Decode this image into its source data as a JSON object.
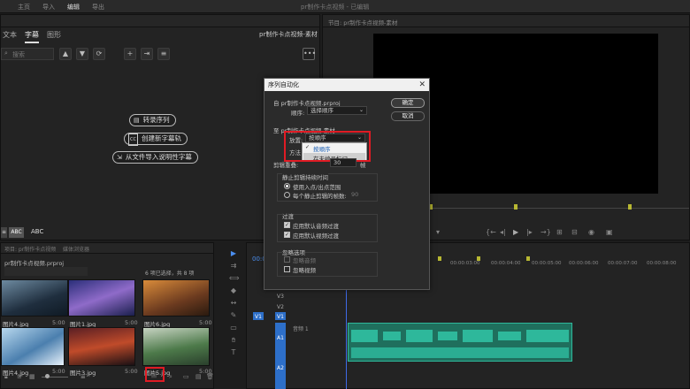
{
  "menu": {
    "tabs": [
      "主页",
      "导入",
      "编辑",
      "导出"
    ],
    "active": "编辑",
    "window_title": "pr制作卡点视频 - 已编辑"
  },
  "text_panel": {
    "tabs": [
      "文本",
      "字幕",
      "图形"
    ],
    "active_tab": "字幕",
    "sequence_name": "pr制作卡点视频-素材",
    "search_placeholder": "搜索",
    "transcribe_label": "转录序列",
    "new_caption_label": "创建新字幕轨",
    "import_caption_label": "从文件导入说明性字幕",
    "cc_icon_text": "CC",
    "style_chips": [
      "ABC",
      "ABC"
    ]
  },
  "program_monitor": {
    "title": "节目: pr制作卡点视频-素材"
  },
  "project_panel": {
    "tabs": [
      "项目: pr制作卡点视频",
      "媒体浏览器"
    ],
    "file_name": "pr制作卡点视频.prproj",
    "selection_status": "6 项已选择，共 8 项",
    "thumbnails": [
      {
        "name": "图片4.jpg",
        "duration": "5:00"
      },
      {
        "name": "图片1.jpg",
        "duration": "5:00"
      },
      {
        "name": "图片6.jpg",
        "duration": "5:00"
      },
      {
        "name": "图片4.jpg",
        "duration": "5:00"
      },
      {
        "name": "图片3.jpg",
        "duration": "5:00"
      },
      {
        "name": "图片5.jpg",
        "duration": "5:00"
      }
    ]
  },
  "dialog": {
    "title": "序列自动化",
    "from_label": "自 pr制作卡点视频.prproj",
    "order_label": "顺序:",
    "order_value": "选择顺序",
    "to_label": "至 pr制作卡点视频-素材",
    "placement_label": "放置:",
    "placement_value": "按顺序",
    "method_label": "方法",
    "dropdown_options": [
      {
        "label": "按顺序",
        "checked": true
      },
      {
        "label": "在未编号标记",
        "checked": false
      }
    ],
    "clip_overlap_label": "剪辑重叠:",
    "clip_overlap_value": "30",
    "clip_overlap_unit": "帧",
    "still_clip_label": "静止剪辑持续时间",
    "radio_in_out": "使用入点/出点范围",
    "radio_frames": "每个静止剪辑的帧数:",
    "frames_value": "90",
    "transitions_label": "过渡",
    "apply_audio_transition": "应用默认音频过渡",
    "apply_video_transition": "应用默认视频过渡",
    "ignore_options_label": "忽略选项",
    "ignore_audio": "忽略音频",
    "ignore_video": "忽略视频",
    "ok_label": "确定",
    "cancel_label": "取消"
  },
  "timeline": {
    "timecode": "00:00:00:00",
    "ruler": [
      "00:00:03:00",
      "00:00:04:00",
      "00:00:05:00",
      "00:00:06:00",
      "00:00:07:00",
      "00:00:08:00"
    ],
    "video_tracks": [
      "V3",
      "V2",
      "V1"
    ],
    "audio_tracks": [
      "A1",
      "A2"
    ],
    "audio_track_name": "音频 1",
    "source_patch": [
      "V1",
      "A1",
      "A2"
    ]
  },
  "colors": {
    "accent_blue": "#2d8ceb",
    "audio_clip": "#2eb89b",
    "highlight_red": "#e01b24",
    "playhead": "#3f6be8"
  }
}
